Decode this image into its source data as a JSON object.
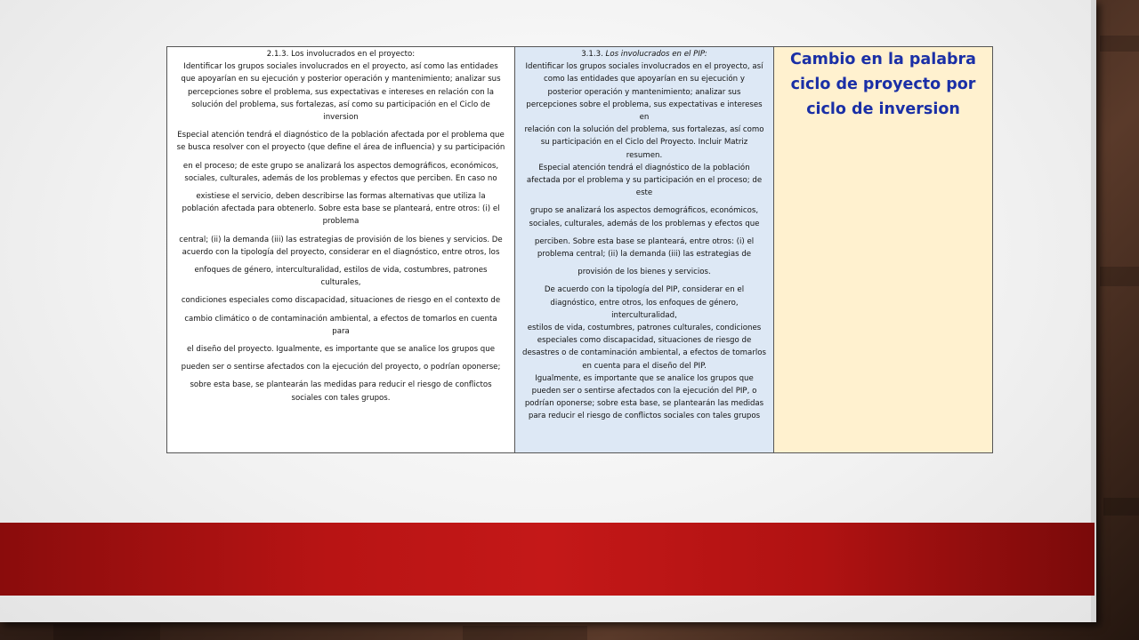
{
  "table": {
    "left": {
      "heading": "2.1.3. Los involucrados en el proyecto:",
      "lines": [
        "Identificar los grupos sociales involucrados en el proyecto, así como las entidades",
        "que apoyarían en su ejecución y posterior operación y mantenimiento; analizar sus",
        "percepciones sobre el problema, sus expectativas e intereses en relación con la",
        "solución del problema, sus fortalezas, así como su participación en el Ciclo de",
        "inversion",
        "",
        "Especial atención tendrá el diagnóstico de la población afectada por el problema que",
        "se busca resolver con el proyecto (que define el área de influencia) y su participación",
        "",
        "en el proceso; de este grupo se analizará los aspectos demográficos, económicos,",
        "sociales, culturales, además de los problemas y efectos que perciben. En caso no",
        "",
        "existiese el servicio, deben describirse las formas alternativas que utiliza la",
        "población afectada para obtenerlo. Sobre esta base se planteará, entre otros: (i) el",
        "problema",
        "",
        "central; (ii) la demanda (iii) las estrategias de provisión de los bienes y servicios. De",
        "acuerdo con la tipología del proyecto, considerar en el diagnóstico, entre otros, los",
        "",
        "enfoques de género, interculturalidad, estilos de vida, costumbres, patrones",
        "culturales,",
        "",
        "condiciones especiales como discapacidad, situaciones de riesgo en el contexto de",
        "",
        "cambio climático o de contaminación ambiental, a efectos de tomarlos en cuenta",
        "para",
        "",
        "el diseño del proyecto. Igualmente, es importante que se analice los grupos que",
        "",
        "pueden ser o sentirse afectados con la ejecución del proyecto, o podrían oponerse;",
        "",
        "sobre esta base, se plantearán las medidas para reducir el riesgo de conflictos",
        "sociales con tales grupos."
      ]
    },
    "middle": {
      "heading_num": "3.1.3.",
      "heading_text": "Los involucrados en el PIP:",
      "lines": [
        "Identificar los grupos sociales involucrados en el proyecto, así",
        "como las entidades que apoyarían en su ejecución y",
        "posterior operación y mantenimiento; analizar sus",
        "percepciones sobre el problema, sus expectativas e intereses",
        "en",
        "relación con la solución del problema, sus fortalezas, así como",
        "su participación en el Ciclo del Proyecto. Incluir Matriz",
        "resumen.",
        "Especial atención tendrá el diagnóstico de la población",
        "afectada por el problema y su participación en el proceso; de",
        "este",
        "",
        "grupo se analizará los aspectos demográficos, económicos,",
        "sociales, culturales, además de los problemas y efectos que",
        "",
        "perciben. Sobre esta base se planteará, entre otros: (i) el",
        "problema central; (ii) la demanda (iii) las estrategias de",
        "",
        "provisión de los bienes y servicios.",
        "",
        "De acuerdo con la tipología del PIP, considerar en el",
        "diagnóstico, entre otros, los enfoques de género,",
        "interculturalidad,",
        "estilos de vida, costumbres, patrones culturales, condiciones",
        "especiales como discapacidad, situaciones de riesgo de",
        "desastres o de contaminación ambiental, a efectos de tomarlos",
        "en cuenta para el diseño del PIP.",
        "Igualmente, es importante que se analice los grupos que",
        "pueden ser o sentirse afectados con la ejecución del PIP, o",
        "podrían oponerse; sobre esta base, se plantearán las medidas",
        "para reducir el riesgo de conflictos sociales con tales grupos"
      ]
    },
    "comment": "Cambio en la palabra ciclo de proyecto por ciclo de inversion"
  },
  "colors": {
    "comment_text": "#1a2fa6",
    "middle_bg": "#dde8f5",
    "comment_bg": "#fff1cf",
    "band": "#b81414"
  }
}
